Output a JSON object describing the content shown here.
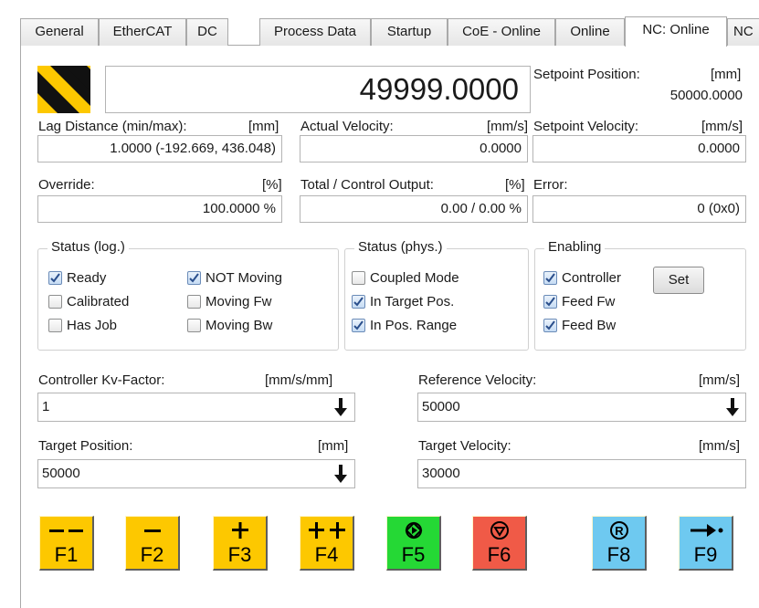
{
  "tabs": [
    {
      "label": "General"
    },
    {
      "label": "EtherCAT"
    },
    {
      "label": "DC"
    },
    {
      "label": "Process Data"
    },
    {
      "label": "Startup"
    },
    {
      "label": "CoE - Online"
    },
    {
      "label": "Online"
    },
    {
      "label": "NC: Online"
    },
    {
      "label": "NC"
    }
  ],
  "active_tab": "NC: Online",
  "actual_position": {
    "value": "49999.0000"
  },
  "setpoint_position": {
    "label": "Setpoint Position:",
    "unit": "[mm]",
    "value": "50000.0000"
  },
  "lag_distance": {
    "label": "Lag Distance (min/max):",
    "unit": "[mm]",
    "value": "1.0000  (-192.669, 436.048)"
  },
  "actual_velocity": {
    "label": "Actual Velocity:",
    "unit": "[mm/s]",
    "value": "0.0000"
  },
  "setpoint_velocity": {
    "label": "Setpoint Velocity:",
    "unit": "[mm/s]",
    "value": "0.0000"
  },
  "override": {
    "label": "Override:",
    "unit": "[%]",
    "value": "100.0000 %"
  },
  "control_output": {
    "label": "Total / Control Output:",
    "unit": "[%]",
    "value": "0.00 /  0.00 %"
  },
  "error": {
    "label": "Error:",
    "value": "0 (0x0)"
  },
  "status_log": {
    "title": "Status (log.)",
    "items": [
      {
        "label": "Ready",
        "checked": true
      },
      {
        "label": "Calibrated",
        "checked": false
      },
      {
        "label": "Has Job",
        "checked": false
      },
      {
        "label": "NOT Moving",
        "checked": true
      },
      {
        "label": "Moving Fw",
        "checked": false
      },
      {
        "label": "Moving Bw",
        "checked": false
      }
    ]
  },
  "status_phys": {
    "title": "Status (phys.)",
    "items": [
      {
        "label": "Coupled Mode",
        "checked": false
      },
      {
        "label": "In Target Pos.",
        "checked": true
      },
      {
        "label": "In Pos. Range",
        "checked": true
      }
    ]
  },
  "enabling": {
    "title": "Enabling",
    "items": [
      {
        "label": "Controller",
        "checked": true
      },
      {
        "label": "Feed Fw",
        "checked": true
      },
      {
        "label": "Feed Bw",
        "checked": true
      }
    ],
    "set_label": "Set"
  },
  "kv_factor": {
    "label": "Controller Kv-Factor:",
    "unit": "[mm/s/mm]",
    "value": "1"
  },
  "reference_velocity": {
    "label": "Reference Velocity:",
    "unit": "[mm/s]",
    "value": "50000"
  },
  "target_position": {
    "label": "Target Position:",
    "unit": "[mm]",
    "value": "50000"
  },
  "target_velocity": {
    "label": "Target Velocity:",
    "unit": "[mm/s]",
    "value": "30000"
  },
  "fkeys": [
    {
      "label": "F1",
      "symbol": "– –",
      "color": "#fdc800"
    },
    {
      "label": "F2",
      "symbol": "–",
      "color": "#fdc800"
    },
    {
      "label": "F3",
      "symbol": "+",
      "color": "#fdc800"
    },
    {
      "label": "F4",
      "symbol": "+ +",
      "color": "#fdc800"
    },
    {
      "label": "F5",
      "symbol": "start-icon",
      "color": "#25d835"
    },
    {
      "label": "F6",
      "symbol": "stop-icon",
      "color": "#f05a47"
    },
    {
      "label": "F8",
      "symbol": "reset-icon",
      "color": "#6ec9f0"
    },
    {
      "label": "F9",
      "symbol": "arrow-right-icon",
      "color": "#6ec9f0"
    }
  ]
}
